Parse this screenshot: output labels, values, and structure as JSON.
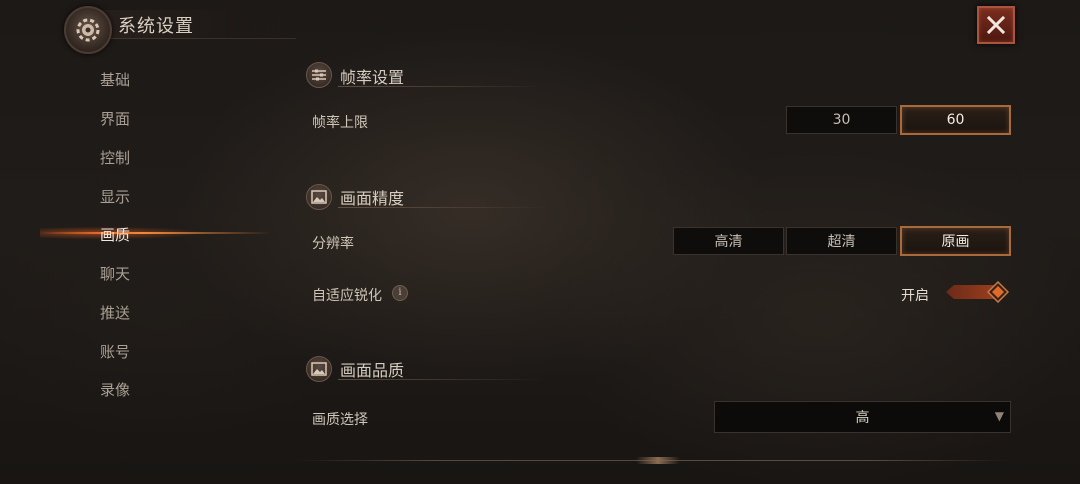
{
  "header": {
    "title": "系统设置",
    "close_icon": "close-icon"
  },
  "sidebar": {
    "items": [
      {
        "label": "基础"
      },
      {
        "label": "界面"
      },
      {
        "label": "控制"
      },
      {
        "label": "显示"
      },
      {
        "label": "画质",
        "active": true
      },
      {
        "label": "聊天"
      },
      {
        "label": "推送"
      },
      {
        "label": "账号"
      },
      {
        "label": "录像"
      }
    ]
  },
  "sections": {
    "frame_rate": {
      "title": "帧率设置",
      "icon": "sliders-icon",
      "row_label": "帧率上限",
      "options": [
        "30",
        "60"
      ],
      "selected": "60"
    },
    "precision": {
      "title": "画面精度",
      "icon": "picture-icon",
      "resolution_label": "分辨率",
      "resolution_options": [
        "高清",
        "超清",
        "原画"
      ],
      "resolution_selected": "原画",
      "sharpen_label": "自适应锐化",
      "sharpen_info_icon": "info-icon",
      "sharpen_state": "开启"
    },
    "quality": {
      "title": "画面品质",
      "icon": "picture-icon",
      "row_label": "画质选择",
      "value": "高"
    }
  },
  "colors": {
    "accent": "#a86a3a",
    "active_glow": "#e06a2a",
    "close_button": "#7a2d1f"
  }
}
